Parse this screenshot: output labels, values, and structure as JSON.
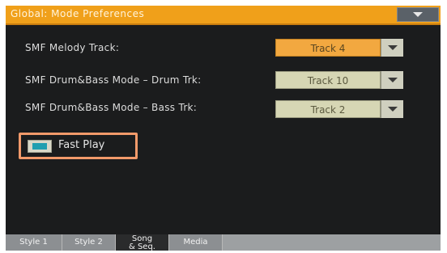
{
  "header": {
    "title": "Global: Mode Preferences",
    "menu_icon": "chevron-down-icon"
  },
  "settings": [
    {
      "label": "SMF Melody Track:",
      "value": "Track 4"
    },
    {
      "label": "SMF Drum&Bass Mode – Drum Trk:",
      "value": "Track 10"
    },
    {
      "label": "SMF Drum&Bass Mode – Bass Trk:",
      "value": "Track 2"
    }
  ],
  "fast_play": {
    "label": "Fast Play",
    "checked": true
  },
  "tabs": [
    {
      "label": "Style 1",
      "active": false
    },
    {
      "label": "Style 2",
      "active": false
    },
    {
      "label": "Song\n& Seq.",
      "active": true
    },
    {
      "label": "Media",
      "active": false
    }
  ],
  "colors": {
    "title_bar": "#f0a01a",
    "highlight_dropdown": "#f2a840",
    "normal_dropdown": "#d6d6b4",
    "checkbox_fill": "#1f9fb0",
    "callout_border": "#f29a6a"
  }
}
